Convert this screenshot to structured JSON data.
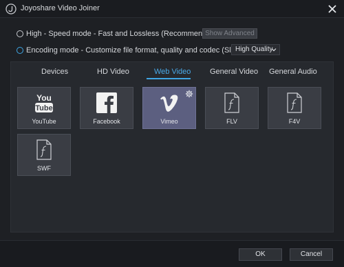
{
  "window": {
    "title": "Joyoshare Video Joiner",
    "logo_icon": "joyoshare-logo-icon",
    "close_icon": "close-icon"
  },
  "modes": {
    "high_speed": {
      "label": "High - Speed mode - Fast and Lossless (Recommended)",
      "selected": false
    },
    "show_advanced_label": "Show Advanced",
    "encoding": {
      "label": "Encoding mode - Customize file format, quality and codec (Slow)",
      "selected": true
    },
    "quality_value": "High Quality"
  },
  "tabs": [
    {
      "label": "Devices",
      "active": false
    },
    {
      "label": "HD Video",
      "active": false
    },
    {
      "label": "Web Video",
      "active": true
    },
    {
      "label": "General Video",
      "active": false
    },
    {
      "label": "General Audio",
      "active": false
    }
  ],
  "formats": [
    {
      "label": "YouTube",
      "icon": "youtube-icon",
      "selected": false
    },
    {
      "label": "Facebook",
      "icon": "facebook-icon",
      "selected": false
    },
    {
      "label": "Vimeo",
      "icon": "vimeo-icon",
      "selected": true
    },
    {
      "label": "FLV",
      "icon": "flash-file-icon",
      "selected": false
    },
    {
      "label": "F4V",
      "icon": "flash-file-icon",
      "selected": false
    },
    {
      "label": "SWF",
      "icon": "flash-file-icon",
      "selected": false
    }
  ],
  "footer": {
    "ok_label": "OK",
    "cancel_label": "Cancel"
  },
  "colors": {
    "accent": "#3fa7e6",
    "background": "#1e2024",
    "selected_tile": "#5c5f80"
  }
}
